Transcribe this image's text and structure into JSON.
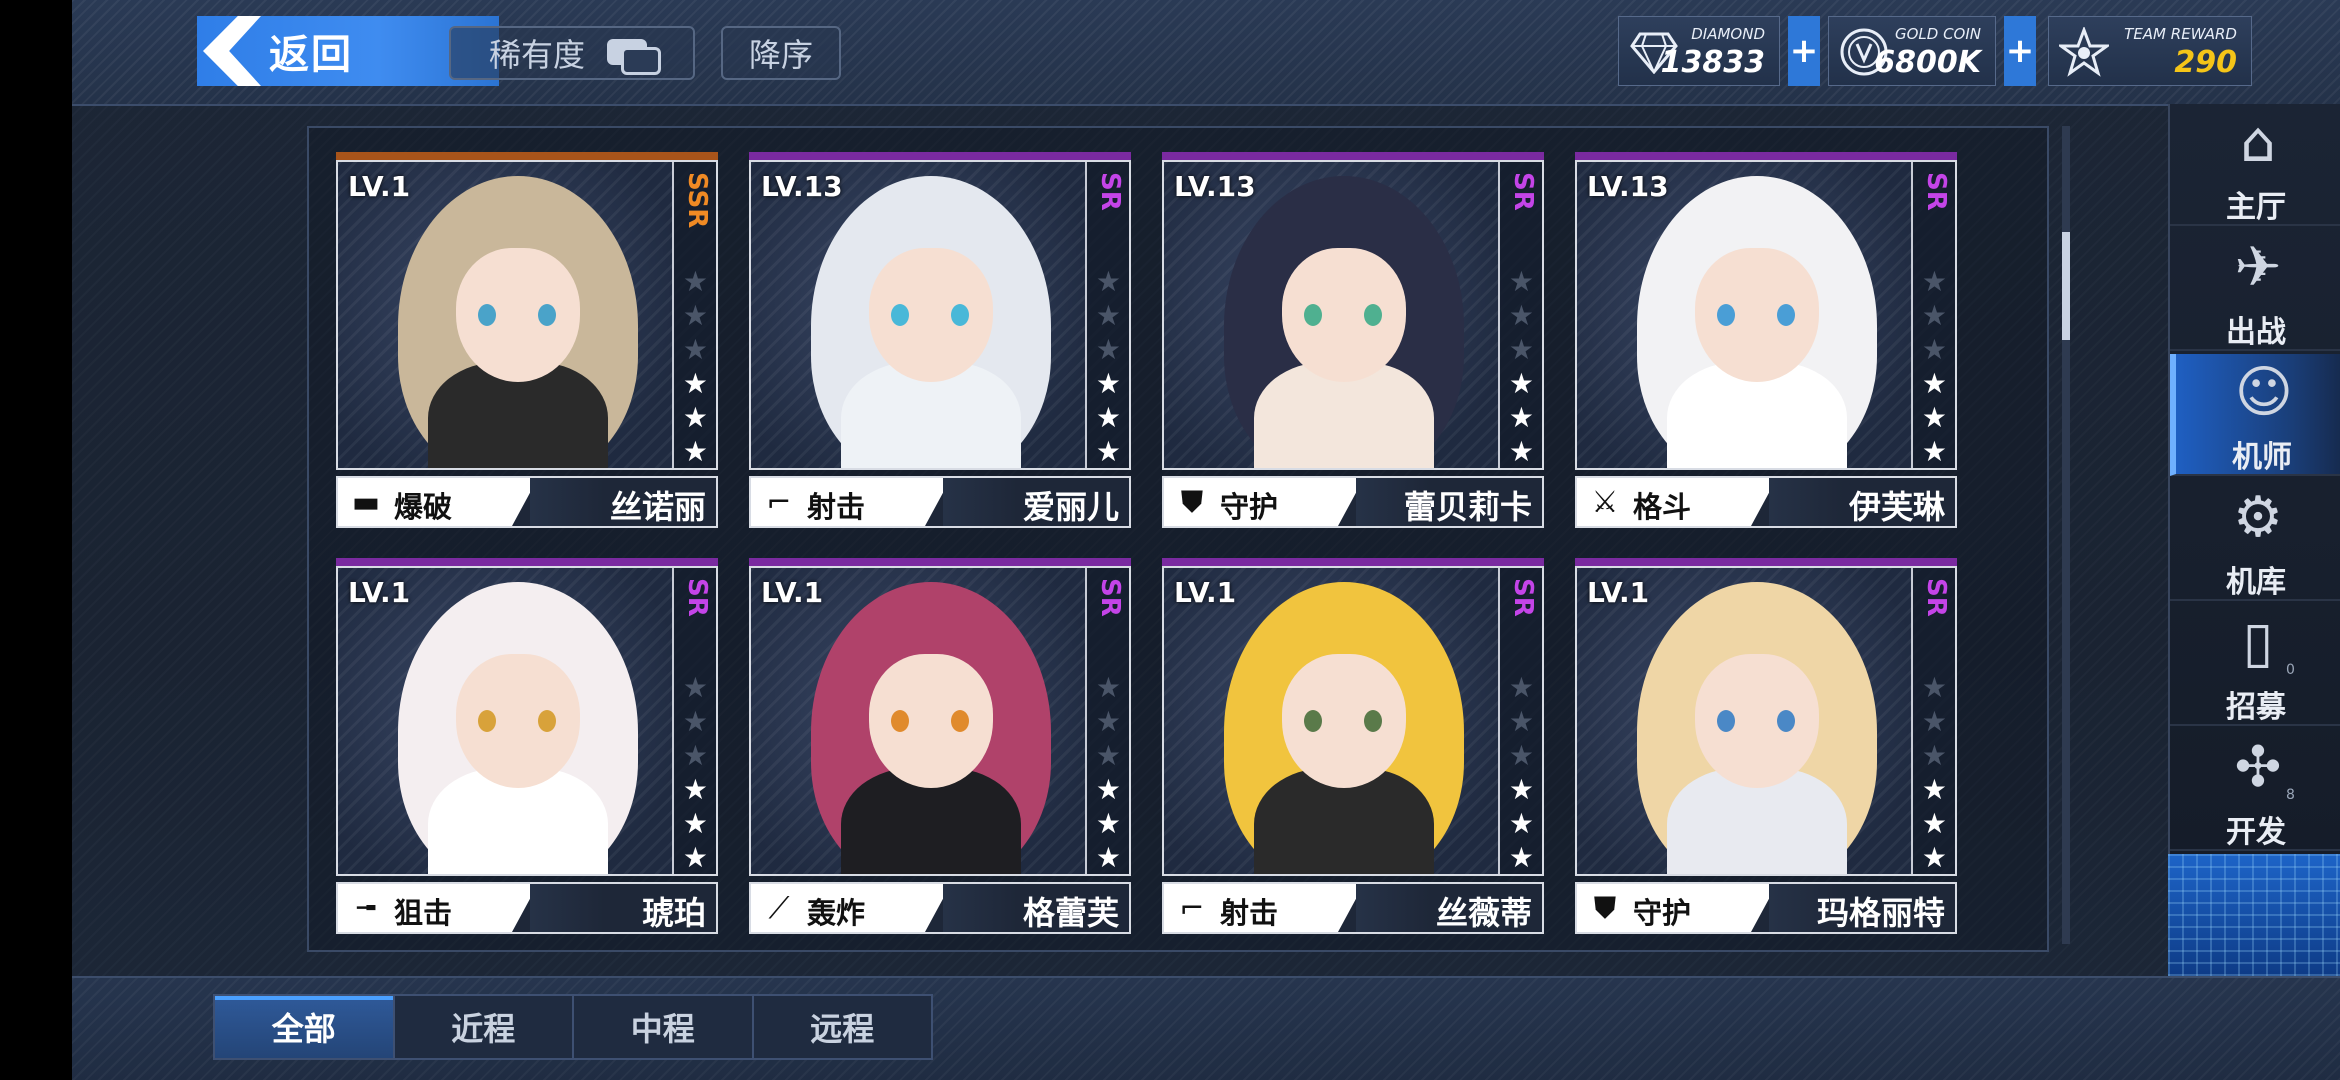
{
  "header": {
    "back_label": "返回",
    "sort_rarity_label": "稀有度",
    "sort_order_label": "降序"
  },
  "resources": {
    "diamond": {
      "name": "DIAMOND",
      "value": "13833",
      "icon": "diamond-icon"
    },
    "gold": {
      "name": "GOLD COIN",
      "value": "6800K",
      "icon": "coin-icon"
    },
    "team": {
      "name": "TEAM REWARD",
      "value": "290",
      "icon": "star-emblem-icon"
    },
    "plus_label": "+"
  },
  "pilots": [
    {
      "level": "LV.1",
      "rarity": "SSR",
      "rarity_color": "#f08a24",
      "stars": 3,
      "role": "爆破",
      "role_icon": "grenade-launcher-icon",
      "name": "丝诺丽",
      "hair": "#c9b79a",
      "eye": "#4aa3c9",
      "outfit": "#2a2a2a"
    },
    {
      "level": "LV.13",
      "rarity": "SR",
      "rarity_color": "#c444e8",
      "stars": 3,
      "role": "射击",
      "role_icon": "rifle-icon",
      "name": "爱丽儿",
      "hair": "#e4e8ef",
      "eye": "#49b8d8",
      "outfit": "#eef2f6"
    },
    {
      "level": "LV.13",
      "rarity": "SR",
      "rarity_color": "#c444e8",
      "stars": 3,
      "role": "守护",
      "role_icon": "shield-icon",
      "name": "蕾贝莉卡",
      "hair": "#2a2e46",
      "eye": "#4fb090",
      "outfit": "#f3e6dc"
    },
    {
      "level": "LV.13",
      "rarity": "SR",
      "rarity_color": "#c444e8",
      "stars": 3,
      "role": "格斗",
      "role_icon": "crossed-swords-icon",
      "name": "伊芙琳",
      "hair": "#f2f2f4",
      "eye": "#4a9ed6",
      "outfit": "#ffffff"
    },
    {
      "level": "LV.1",
      "rarity": "SR",
      "rarity_color": "#c444e8",
      "stars": 3,
      "role": "狙击",
      "role_icon": "sniper-rifle-icon",
      "name": "琥珀",
      "hair": "#f4eef0",
      "eye": "#d8a23a",
      "outfit": "#ffffff"
    },
    {
      "level": "LV.1",
      "rarity": "SR",
      "rarity_color": "#c444e8",
      "stars": 3,
      "role": "轰炸",
      "role_icon": "mortar-icon",
      "name": "格蕾芙",
      "hair": "#b0426a",
      "eye": "#e08a2c",
      "outfit": "#1e1e22"
    },
    {
      "level": "LV.1",
      "rarity": "SR",
      "rarity_color": "#c444e8",
      "stars": 3,
      "role": "射击",
      "role_icon": "rifle-icon",
      "name": "丝薇蒂",
      "hair": "#f1c43e",
      "eye": "#5a7a4a",
      "outfit": "#2a2a2a"
    },
    {
      "level": "LV.1",
      "rarity": "SR",
      "rarity_color": "#c444e8",
      "stars": 3,
      "role": "守护",
      "role_icon": "shield-icon",
      "name": "玛格丽特",
      "hair": "#efd6a6",
      "eye": "#4a88c6",
      "outfit": "#e8eaf0"
    }
  ],
  "nav": [
    {
      "label": "主厅",
      "icon": "hall-icon",
      "active": false
    },
    {
      "label": "出战",
      "icon": "sortie-icon",
      "active": false
    },
    {
      "label": "机师",
      "icon": "pilot-icon",
      "active": true
    },
    {
      "label": "机库",
      "icon": "hangar-icon",
      "active": false
    },
    {
      "label": "招募",
      "icon": "recruit-card-icon",
      "active": false,
      "badge": "0"
    },
    {
      "label": "开发",
      "icon": "wrench-gear-icon",
      "active": false,
      "badge": "8"
    }
  ],
  "tabs": [
    {
      "label": "全部",
      "active": true
    },
    {
      "label": "近程",
      "active": false
    },
    {
      "label": "中程",
      "active": false
    },
    {
      "label": "远程",
      "active": false
    }
  ],
  "colors": {
    "accent_blue": "#2f7ee8",
    "ssr_orange": "#f08a24",
    "sr_purple": "#c444e8",
    "team_reward_value": "#f5c518"
  }
}
